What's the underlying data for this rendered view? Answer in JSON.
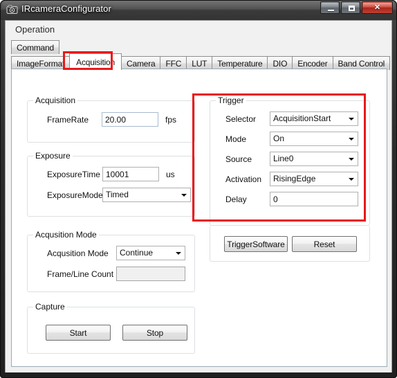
{
  "window": {
    "title": "IRcameraConfigurator",
    "icon": "camera-icon",
    "buttons": {
      "minimize": "minimize-icon",
      "maximize": "maximize-icon",
      "close": "✕"
    }
  },
  "menubar": {
    "items": [
      "Operation"
    ]
  },
  "tabs": {
    "row1": [
      {
        "label": "Command",
        "selected": false
      }
    ],
    "row2": [
      {
        "label": "ImageFormat",
        "selected": false
      },
      {
        "label": "Acquisition",
        "selected": true
      },
      {
        "label": "Camera",
        "selected": false
      },
      {
        "label": "FFC",
        "selected": false
      },
      {
        "label": "LUT",
        "selected": false
      },
      {
        "label": "Temperature",
        "selected": false
      },
      {
        "label": "DIO",
        "selected": false
      },
      {
        "label": "Encoder",
        "selected": false
      },
      {
        "label": "Band Control",
        "selected": false
      }
    ]
  },
  "acquisition_group": {
    "title": "Acquisition",
    "framerate_label": "FrameRate",
    "framerate_value": "20.00",
    "framerate_unit": "fps"
  },
  "exposure_group": {
    "title": "Exposure",
    "exposure_time_label": "ExposureTime",
    "exposure_time_value": "10001",
    "exposure_time_unit": "us",
    "exposure_mode_label": "ExposureMode",
    "exposure_mode_value": "Timed"
  },
  "acquisition_mode_group": {
    "title": "Acqusition Mode",
    "mode_label": "Acqusition Mode",
    "mode_value": "Continue",
    "count_label": "Frame/Line Count",
    "count_value": ""
  },
  "capture_group": {
    "title": "Capture",
    "start_label": "Start",
    "stop_label": "Stop"
  },
  "trigger_group": {
    "title": "Trigger",
    "selector_label": "Selector",
    "selector_value": "AcquisitionStart",
    "mode_label": "Mode",
    "mode_value": "On",
    "source_label": "Source",
    "source_value": "Line0",
    "activation_label": "Activation",
    "activation_value": "RisingEdge",
    "delay_label": "Delay",
    "delay_value": "0",
    "trigger_software_label": "TriggerSoftware",
    "reset_label": "Reset"
  },
  "annotations": {
    "highlight_color": "#e81919",
    "boxes": [
      "acquisition-tab-highlight",
      "trigger-group-highlight"
    ]
  }
}
